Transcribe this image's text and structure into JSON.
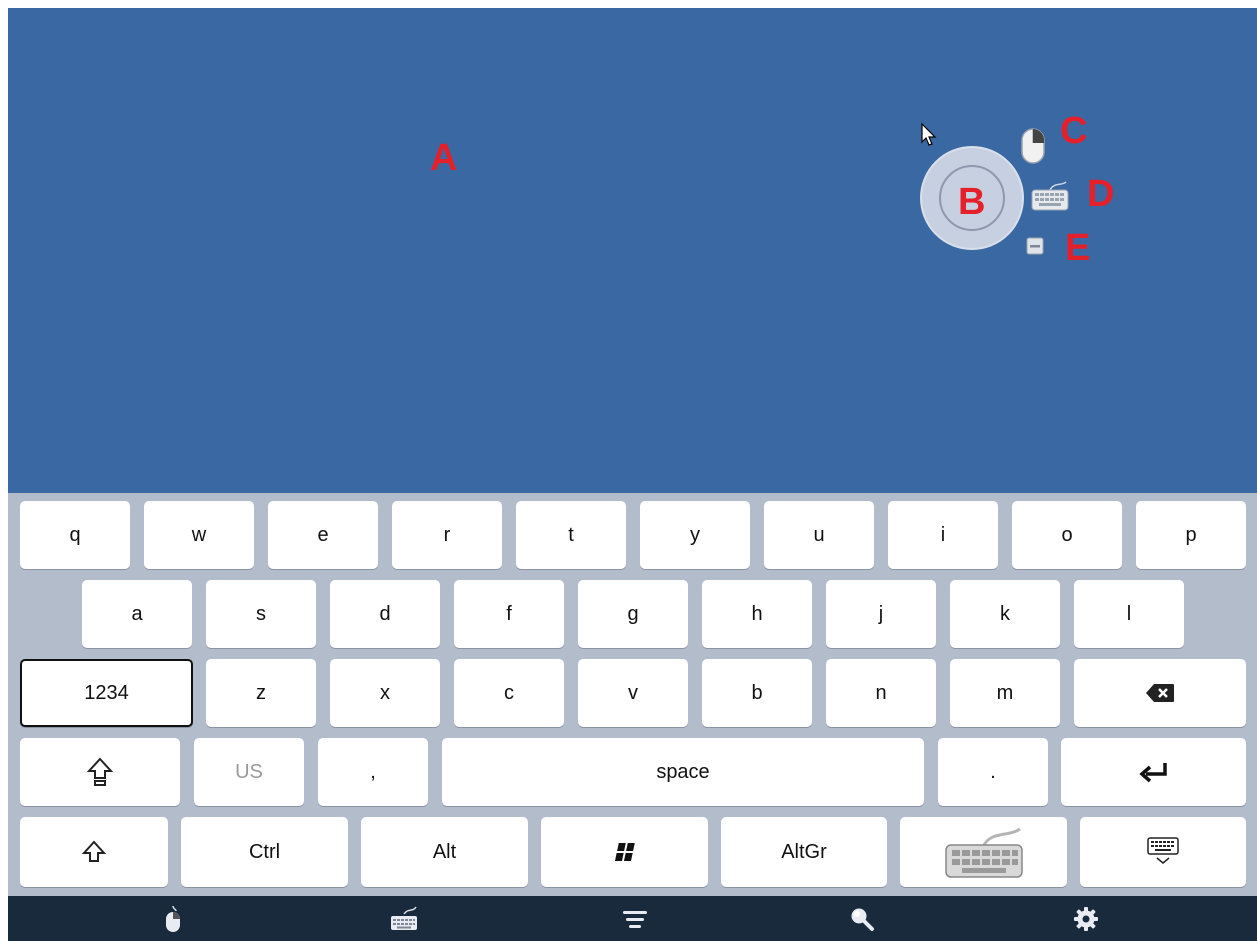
{
  "annotations": {
    "a": "A",
    "b": "B",
    "c": "C",
    "d": "D",
    "e": "E"
  },
  "colors": {
    "desktop": "#3a68a2",
    "annotation": "#e5202a",
    "keyboard_bg": "#b2bccb",
    "taskbar": "#1a2a3d"
  },
  "keyboard": {
    "row1": [
      "q",
      "w",
      "e",
      "r",
      "t",
      "y",
      "u",
      "i",
      "o",
      "p"
    ],
    "row2": [
      "a",
      "s",
      "d",
      "f",
      "g",
      "h",
      "j",
      "k",
      "l"
    ],
    "row3": {
      "mode": "1234",
      "keys": [
        "z",
        "x",
        "c",
        "v",
        "b",
        "n",
        "m"
      ],
      "backspace_icon": "backspace-icon"
    },
    "row4": {
      "shift_lock_icon": "caps-lock-icon",
      "layout": "US",
      "comma": ",",
      "space": "space",
      "period": ".",
      "enter_icon": "enter-icon"
    },
    "row5": {
      "shift_icon": "shift-icon",
      "ctrl": "Ctrl",
      "alt": "Alt",
      "win_icon": "windows-icon",
      "altgr": "AltGr",
      "keyboard_icon": "keyboard-icon",
      "hide_icon": "hide-keyboard-icon"
    }
  },
  "taskbar": [
    "mouse-icon",
    "keyboard-icon",
    "menu-icon",
    "search-icon",
    "gear-icon"
  ]
}
